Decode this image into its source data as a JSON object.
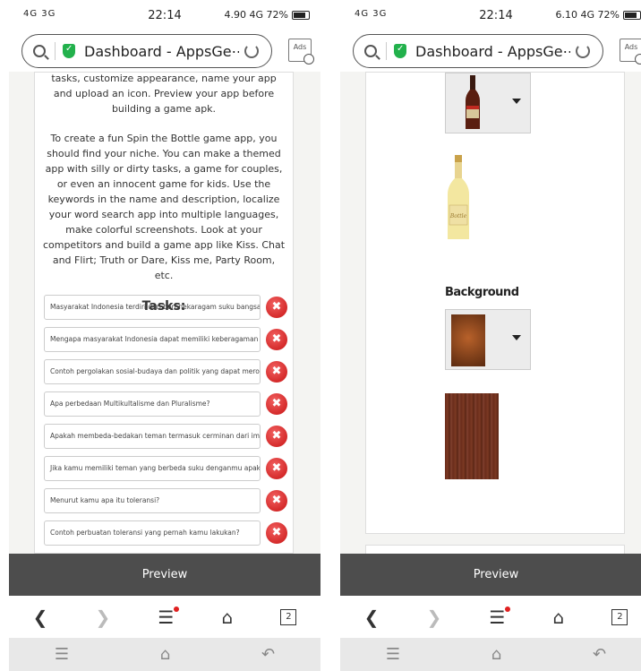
{
  "status": {
    "left_indicators": "4G 3G",
    "time": "22:14",
    "right_left_phone": "4.90 4G 72%",
    "right_right_phone": "6.10 4G 72%"
  },
  "browser": {
    "page_title": "Dashboard - AppsGe⋯",
    "ads_label": "Ads",
    "tab_count": "2"
  },
  "description": {
    "intro": "tasks, customize appearance, name your app and upload an icon. Preview your app before building a game apk.",
    "body": "To create a fun Spin the Bottle game app, you should find your niche. You can make a themed app with silly or dirty tasks, a game for couples, or even an innocent game for kids. Use the keywords in the name and description, localize your word search app into multiple languages, make colorful screenshots. Look at your competitors and build a game app like Kiss. Chat and Flirt; Truth or Dare, Kiss me, Party Room, etc."
  },
  "tasks": {
    "title": "Tasks:",
    "items": [
      "Masyarakat Indonesia terdiri dari beranekaragam suku bangsa, as",
      "Mengapa masyarakat Indonesia dapat memiliki keberagaman ata",
      "Contoh pergolakan sosial-budaya dan politik yang dapat merongr",
      "Apa perbedaan Multikultalisme dan Pluralisme?",
      "Apakah membeda-bedakan teman termasuk cerminan dari impler",
      "Jika kamu memiliki teman yang berbeda suku denganmu apakah",
      "Menurut kamu apa itu toleransi?",
      "Contoh perbuatan toleransi yang pernah kamu lakukan?"
    ],
    "delete_glyph": "✖"
  },
  "preview_label": "Preview",
  "appearance": {
    "background_label": "Background",
    "bottle_label_text": "Bottle"
  }
}
